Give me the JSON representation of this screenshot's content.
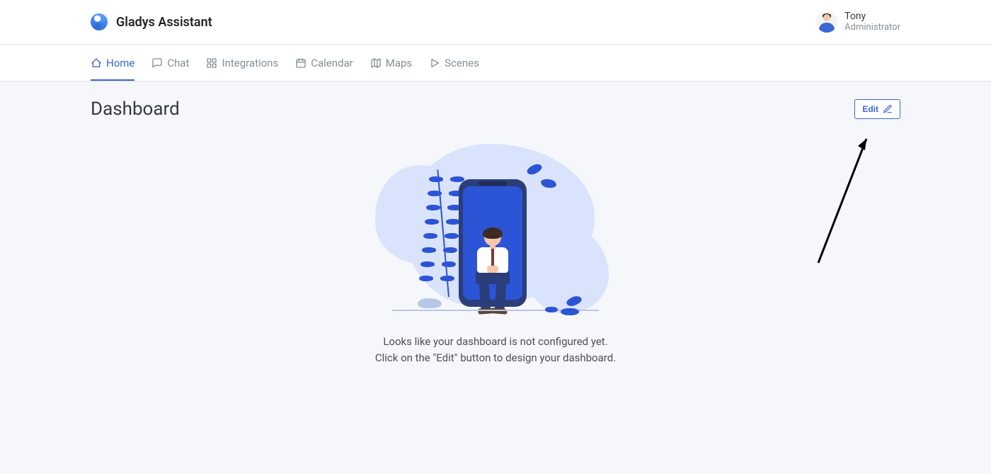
{
  "brand": {
    "name": "Gladys Assistant"
  },
  "user": {
    "name": "Tony",
    "role": "Administrator"
  },
  "nav": {
    "home": "Home",
    "chat": "Chat",
    "integrations": "Integrations",
    "calendar": "Calendar",
    "maps": "Maps",
    "scenes": "Scenes"
  },
  "page": {
    "title": "Dashboard",
    "edit_label": "Edit"
  },
  "empty": {
    "line1": "Looks like your dashboard is not configured yet.",
    "line2": "Click on the \"Edit\" button to design your dashboard."
  }
}
